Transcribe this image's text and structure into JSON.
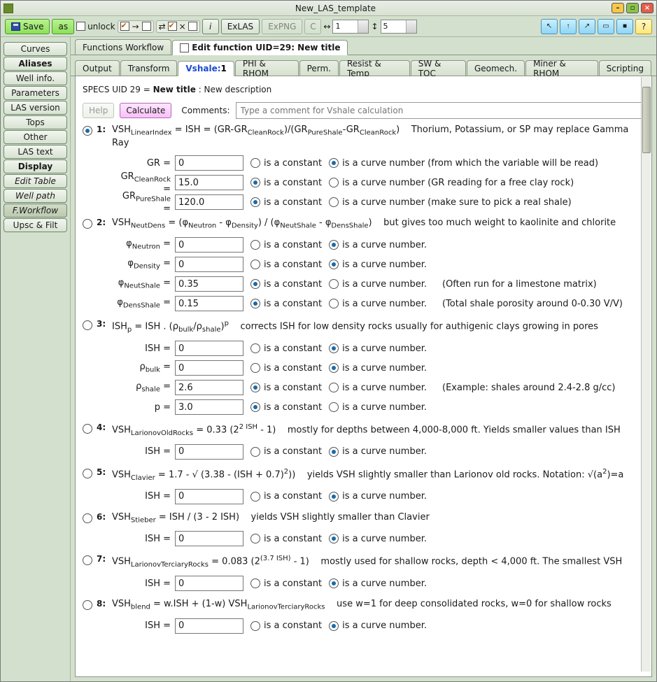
{
  "window": {
    "title": "New_LAS_template"
  },
  "toolbar": {
    "save": "Save",
    "as": "as",
    "unlock": "unlock",
    "exlas": "ExLAS",
    "expng": "ExPNG",
    "c": "C",
    "horiz": "1",
    "vert": "5",
    "help": "?",
    "i": "i"
  },
  "sidebar": [
    "Curves",
    "Aliases",
    "Well info.",
    "Parameters",
    "LAS version",
    "Tops",
    "Other",
    "LAS text",
    "Display",
    "Edit Table",
    "Well path",
    "F.Workflow",
    "Upsc & Filt"
  ],
  "top_tabs": {
    "fw": "Functions Workflow",
    "edit": "Edit function UID=29: New title"
  },
  "sub_tabs": [
    "Output",
    "Transform",
    "Vshale:1",
    "PHI & RHOM",
    "Perm.",
    "Resist & Temp",
    "SW & TOC",
    "Geomech.",
    "Miner & RHOM",
    "Scripting"
  ],
  "specs": {
    "prefix": "SPECS UID 29 = ",
    "title": "New title",
    "suffix": " : New description"
  },
  "buttons": {
    "help": "Help",
    "calc": "Calculate"
  },
  "comments": {
    "label": "Comments:",
    "placeholder": "Type a comment for Vshale calculation"
  },
  "common": {
    "const": "is a constant",
    "curve": "is a curve number",
    "curvep": "is a curve number."
  },
  "methods": [
    {
      "n": "1:",
      "sel": true,
      "formula_html": "VSH<span class='sub'>LinearIndex</span> = ISH = (GR-GR<span class='sub'>CleanRock</span>)/(GR<span class='sub'>PureShale</span>-GR<span class='sub'>CleanRock</span>)&nbsp;&nbsp;&nbsp;&nbsp;Thorium, Potassium, or SP may replace Gamma Ray",
      "params": [
        {
          "label": "GR =",
          "val": "0",
          "c": false,
          "cv": true,
          "hint": "(from which the variable will be read)",
          "hintmode": "curve"
        },
        {
          "label_html": "GR<span class='sub'>CleanRock</span> =",
          "val": "15.0",
          "c": true,
          "cv": false,
          "hint": "(GR reading for a free clay rock)",
          "hintmode": "curve"
        },
        {
          "label_html": "GR<span class='sub'>PureShale</span> =",
          "val": "120.0",
          "c": true,
          "cv": false,
          "hint": "(make sure to pick a real shale)",
          "hintmode": "curve"
        }
      ]
    },
    {
      "n": "2:",
      "sel": false,
      "formula_html": "VSH<span class='sub'>NeutDens</span> = (φ<span class='sub'>Neutron</span> - φ<span class='sub'>Density</span>) / (φ<span class='sub'>NeutShale</span> - φ<span class='sub'>DensShale</span>)&nbsp;&nbsp;&nbsp;&nbsp;but gives too much weight to kaolinite and chlorite",
      "params": [
        {
          "label_html": "φ<span class='sub'>Neutron</span> =",
          "val": "0",
          "c": false,
          "cv": true
        },
        {
          "label_html": "φ<span class='sub'>Density</span> =",
          "val": "0",
          "c": false,
          "cv": true
        },
        {
          "label_html": "φ<span class='sub'>NeutShale</span> =",
          "val": "0.35",
          "c": true,
          "cv": false,
          "hint": "(Often run for a limestone matrix)"
        },
        {
          "label_html": "φ<span class='sub'>DensShale</span> =",
          "val": "0.15",
          "c": true,
          "cv": false,
          "hint": "(Total shale porosity around 0-0.30 V/V)"
        }
      ]
    },
    {
      "n": "3:",
      "sel": false,
      "formula_html": "ISH<span class='sub'>p</span> = ISH . (ρ<span class='sub'>bulk</span>/ρ<span class='sub'>shale</span>)<span class='sup'>p</span>&nbsp;&nbsp;&nbsp;&nbsp;corrects ISH for low density rocks usually for authigenic clays growing in pores",
      "params": [
        {
          "label": "ISH =",
          "val": "0",
          "c": false,
          "cv": true
        },
        {
          "label_html": "ρ<span class='sub'>bulk</span> =",
          "val": "0",
          "c": false,
          "cv": true
        },
        {
          "label_html": "ρ<span class='sub'>shale</span> =",
          "val": "2.6",
          "c": true,
          "cv": false,
          "hint": "(Example: shales around 2.4-2.8 g/cc)"
        },
        {
          "label": "p =",
          "val": "3.0",
          "c": true,
          "cv": false
        }
      ]
    },
    {
      "n": "4:",
      "sel": false,
      "formula_html": "VSH<span class='sub'>LarionovOldRocks</span> = 0.33 (2<span class='sup'>2 ISH</span> - 1)&nbsp;&nbsp;&nbsp;&nbsp;mostly for depths between 4,000-8,000 ft. Yields smaller values than ISH",
      "params": [
        {
          "label": "ISH =",
          "val": "0",
          "c": false,
          "cv": true
        }
      ]
    },
    {
      "n": "5:",
      "sel": false,
      "formula_html": "VSH<span class='sub'>Clavier</span> = 1.7 - √ (3.38 - (ISH + 0.7)<span class='sup'>2</span>))&nbsp;&nbsp;&nbsp;&nbsp;yields VSH slightly smaller than Larionov old rocks. Notation: √(a<span class='sup'>2</span>)=a",
      "params": [
        {
          "label": "ISH =",
          "val": "0",
          "c": false,
          "cv": true
        }
      ]
    },
    {
      "n": "6:",
      "sel": false,
      "formula_html": "VSH<span class='sub'>Stieber</span> = ISH / (3 - 2 ISH)&nbsp;&nbsp;&nbsp;&nbsp;yields VSH slightly smaller than Clavier",
      "params": [
        {
          "label": "ISH =",
          "val": "0",
          "c": false,
          "cv": true
        }
      ]
    },
    {
      "n": "7:",
      "sel": false,
      "formula_html": "VSH<span class='sub'>LarionovTerciaryRocks</span> = 0.083 (2<span class='sup'>(3.7 ISH)</span> - 1)&nbsp;&nbsp;&nbsp;&nbsp;mostly used for shallow rocks, depth &lt; 4,000 ft. The smallest VSH",
      "params": [
        {
          "label": "ISH =",
          "val": "0",
          "c": false,
          "cv": true
        }
      ]
    },
    {
      "n": "8:",
      "sel": false,
      "formula_html": "VSH<span class='sub'>blend</span> = w.ISH + (1-w) VSH<span class='sub'>LarionovTerciaryRocks</span>&nbsp;&nbsp;&nbsp;&nbsp;use w=1 for deep consolidated rocks, w=0 for shallow rocks",
      "params": [
        {
          "label": "ISH =",
          "val": "0",
          "c": false,
          "cv": true
        }
      ]
    }
  ]
}
